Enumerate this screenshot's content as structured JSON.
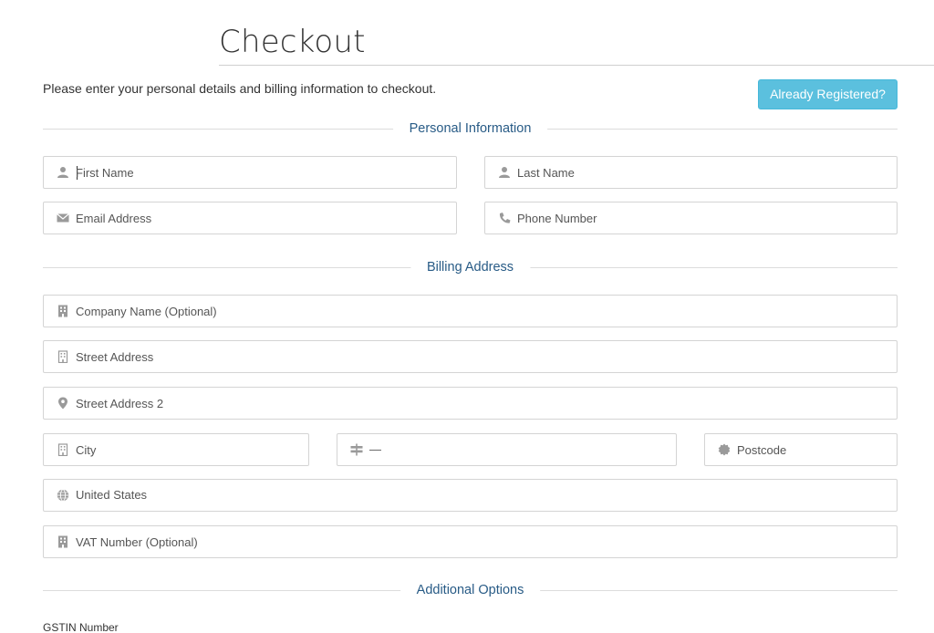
{
  "page": {
    "title": "Checkout",
    "intro": "Please enter your personal details and billing information to checkout.",
    "already_registered_label": "Already Registered?"
  },
  "sections": {
    "personal": "Personal Information",
    "billing": "Billing Address",
    "additional": "Additional Options"
  },
  "personal": {
    "first_name": {
      "placeholder": "First Name",
      "icon": "user-icon"
    },
    "last_name": {
      "placeholder": "Last Name",
      "icon": "user-icon"
    },
    "email": {
      "placeholder": "Email Address",
      "icon": "envelope-icon"
    },
    "phone": {
      "placeholder": "Phone Number",
      "icon": "phone-icon"
    }
  },
  "billing": {
    "company": {
      "placeholder": "Company Name (Optional)",
      "icon": "building-icon"
    },
    "street": {
      "placeholder": "Street Address",
      "icon": "building-outline-icon"
    },
    "street2": {
      "placeholder": "Street Address 2",
      "icon": "map-marker-icon"
    },
    "city": {
      "placeholder": "City",
      "icon": "building-outline-icon"
    },
    "state": {
      "value": "—",
      "icon": "signpost-icon"
    },
    "postcode": {
      "placeholder": "Postcode",
      "icon": "certificate-icon"
    },
    "country": {
      "value": "United States",
      "icon": "globe-icon"
    },
    "vat": {
      "placeholder": "VAT Number (Optional)",
      "icon": "building-icon"
    }
  },
  "additional": {
    "gstin_label": "GSTIN Number"
  },
  "colors": {
    "accent_button": "#5bc0de",
    "section_heading": "#285b86",
    "icon": "#9a9a9a"
  }
}
